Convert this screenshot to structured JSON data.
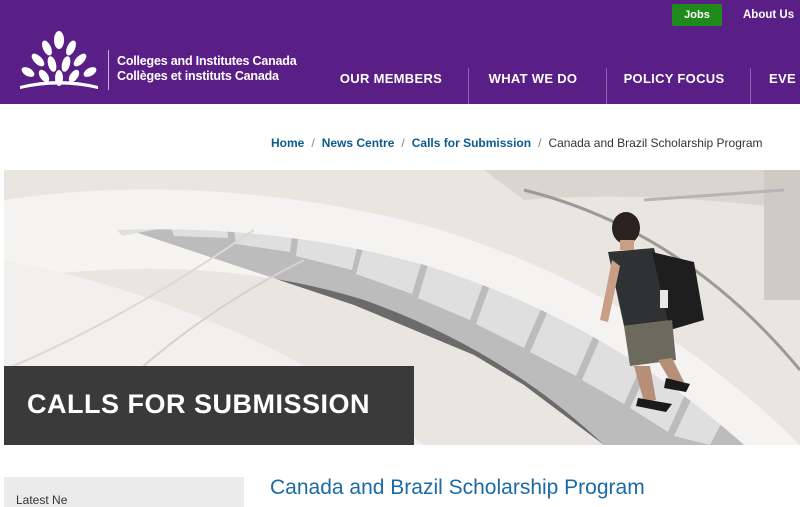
{
  "header": {
    "org_name_en": "Colleges and Institutes Canada",
    "org_name_fr": "Collèges et instituts Canada",
    "jobs_label": "Jobs",
    "about_label": "About Us",
    "nav": [
      "OUR MEMBERS",
      "WHAT WE DO",
      "POLICY FOCUS",
      "EVE"
    ],
    "brand_color": "#5a1f86",
    "jobs_color": "#1f8a1c"
  },
  "breadcrumb": {
    "items": [
      "Home",
      "News Centre",
      "Calls for Submission"
    ],
    "current": "Canada and Brazil Scholarship Program"
  },
  "hero": {
    "title": "CALLS FOR SUBMISSION"
  },
  "sidebar": {
    "partial_text": "Latest Ne"
  },
  "main": {
    "heading": "Canada and Brazil Scholarship Program"
  }
}
